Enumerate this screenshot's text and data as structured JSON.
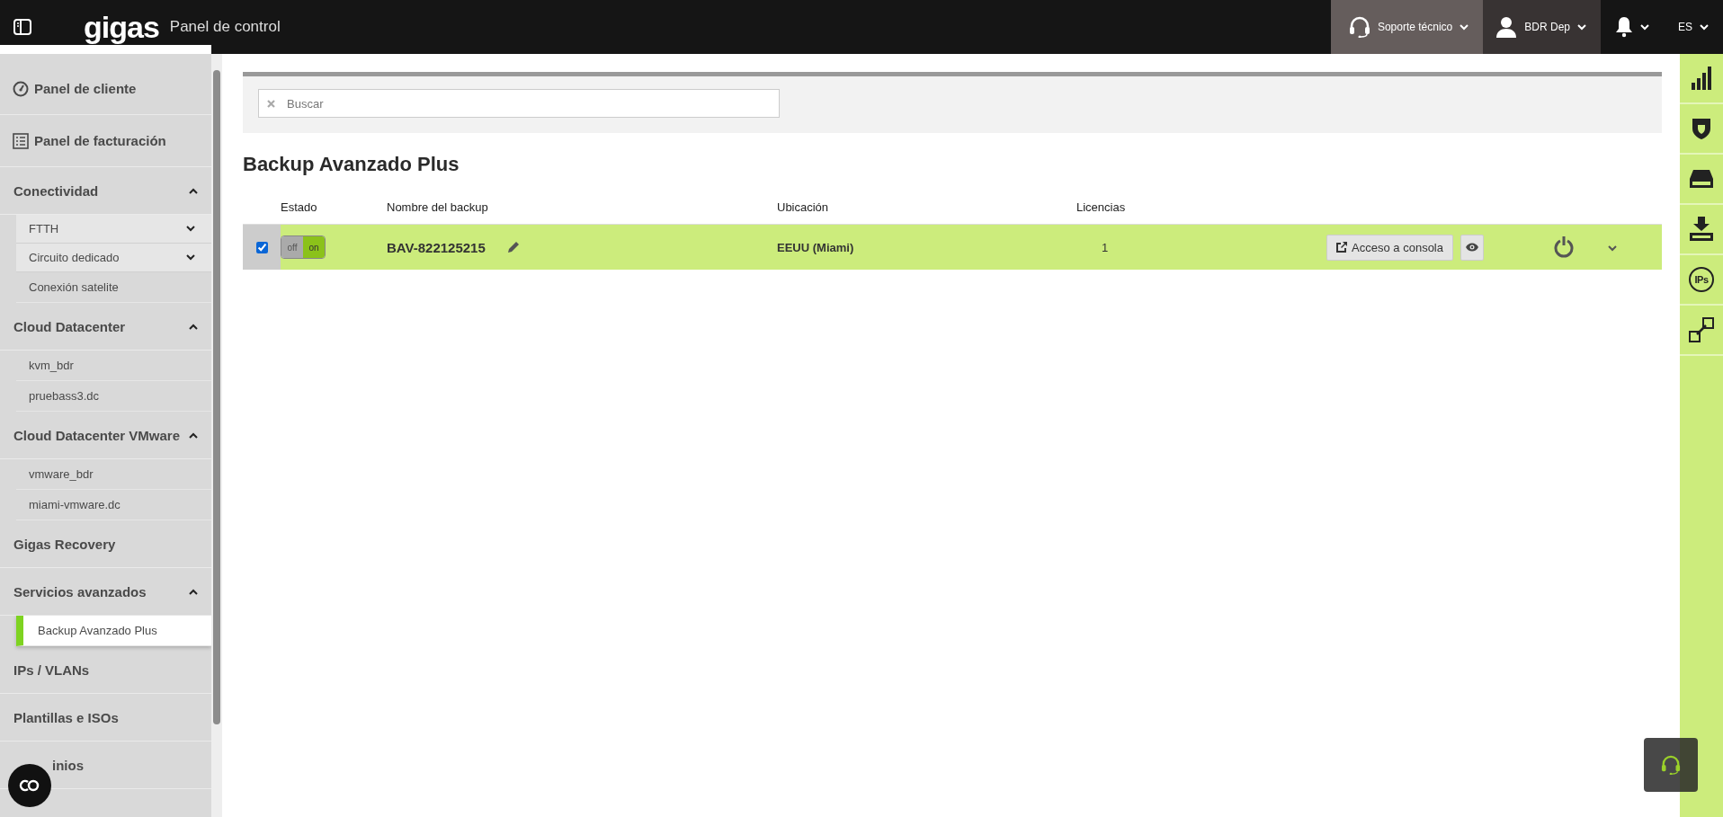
{
  "header": {
    "brand": "gigas",
    "title": "Panel de control",
    "support": "Soporte técnico",
    "user": "BDR Dep",
    "language": "ES"
  },
  "sidebar": {
    "items": [
      {
        "kind": "link",
        "label": "Panel de cliente"
      },
      {
        "kind": "link",
        "label": "Panel de facturación"
      },
      {
        "kind": "section",
        "label": "Conectividad",
        "expanded": true,
        "children": [
          {
            "kind": "sub",
            "label": "FTTH",
            "expanded": false,
            "selected": false
          },
          {
            "kind": "sub",
            "label": "Circuito dedicado",
            "expanded": false,
            "selected": false
          },
          {
            "kind": "leaf",
            "label": "Conexión satelite",
            "selected": false
          }
        ]
      },
      {
        "kind": "section",
        "label": "Cloud Datacenter",
        "expanded": true,
        "children": [
          {
            "kind": "leaf",
            "label": "kvm_bdr",
            "selected": false
          },
          {
            "kind": "leaf",
            "label": "pruebass3.dc",
            "selected": false
          }
        ]
      },
      {
        "kind": "section",
        "label": "Cloud Datacenter VMware",
        "expanded": true,
        "children": [
          {
            "kind": "leaf",
            "label": "vmware_bdr",
            "selected": false
          },
          {
            "kind": "leaf",
            "label": "miami-vmware.dc",
            "selected": false
          }
        ]
      },
      {
        "kind": "group",
        "label": "Gigas Recovery"
      },
      {
        "kind": "section",
        "label": "Servicios avanzados",
        "expanded": true,
        "children": [
          {
            "kind": "leaf",
            "label": "Backup Avanzado Plus",
            "selected": true
          }
        ]
      },
      {
        "kind": "group",
        "label": "IPs / VLANs"
      },
      {
        "kind": "group",
        "label": "Plantillas e ISOs"
      },
      {
        "kind": "group",
        "label": "inios"
      }
    ]
  },
  "search": {
    "placeholder": "Buscar"
  },
  "page_title": "Backup Avanzado Plus",
  "table": {
    "columns": [
      "Estado",
      "Nombre del backup",
      "Ubicación",
      "Licencias"
    ],
    "rows": [
      {
        "selected": true,
        "on": true,
        "toggle_labels": [
          "off",
          "on"
        ],
        "name": "BAV-822125215",
        "location": "EEUU (Miami)",
        "licenses": "1",
        "console": "Acceso a consola"
      }
    ]
  },
  "right_toolbar": {
    "ips_label": "IPs"
  }
}
